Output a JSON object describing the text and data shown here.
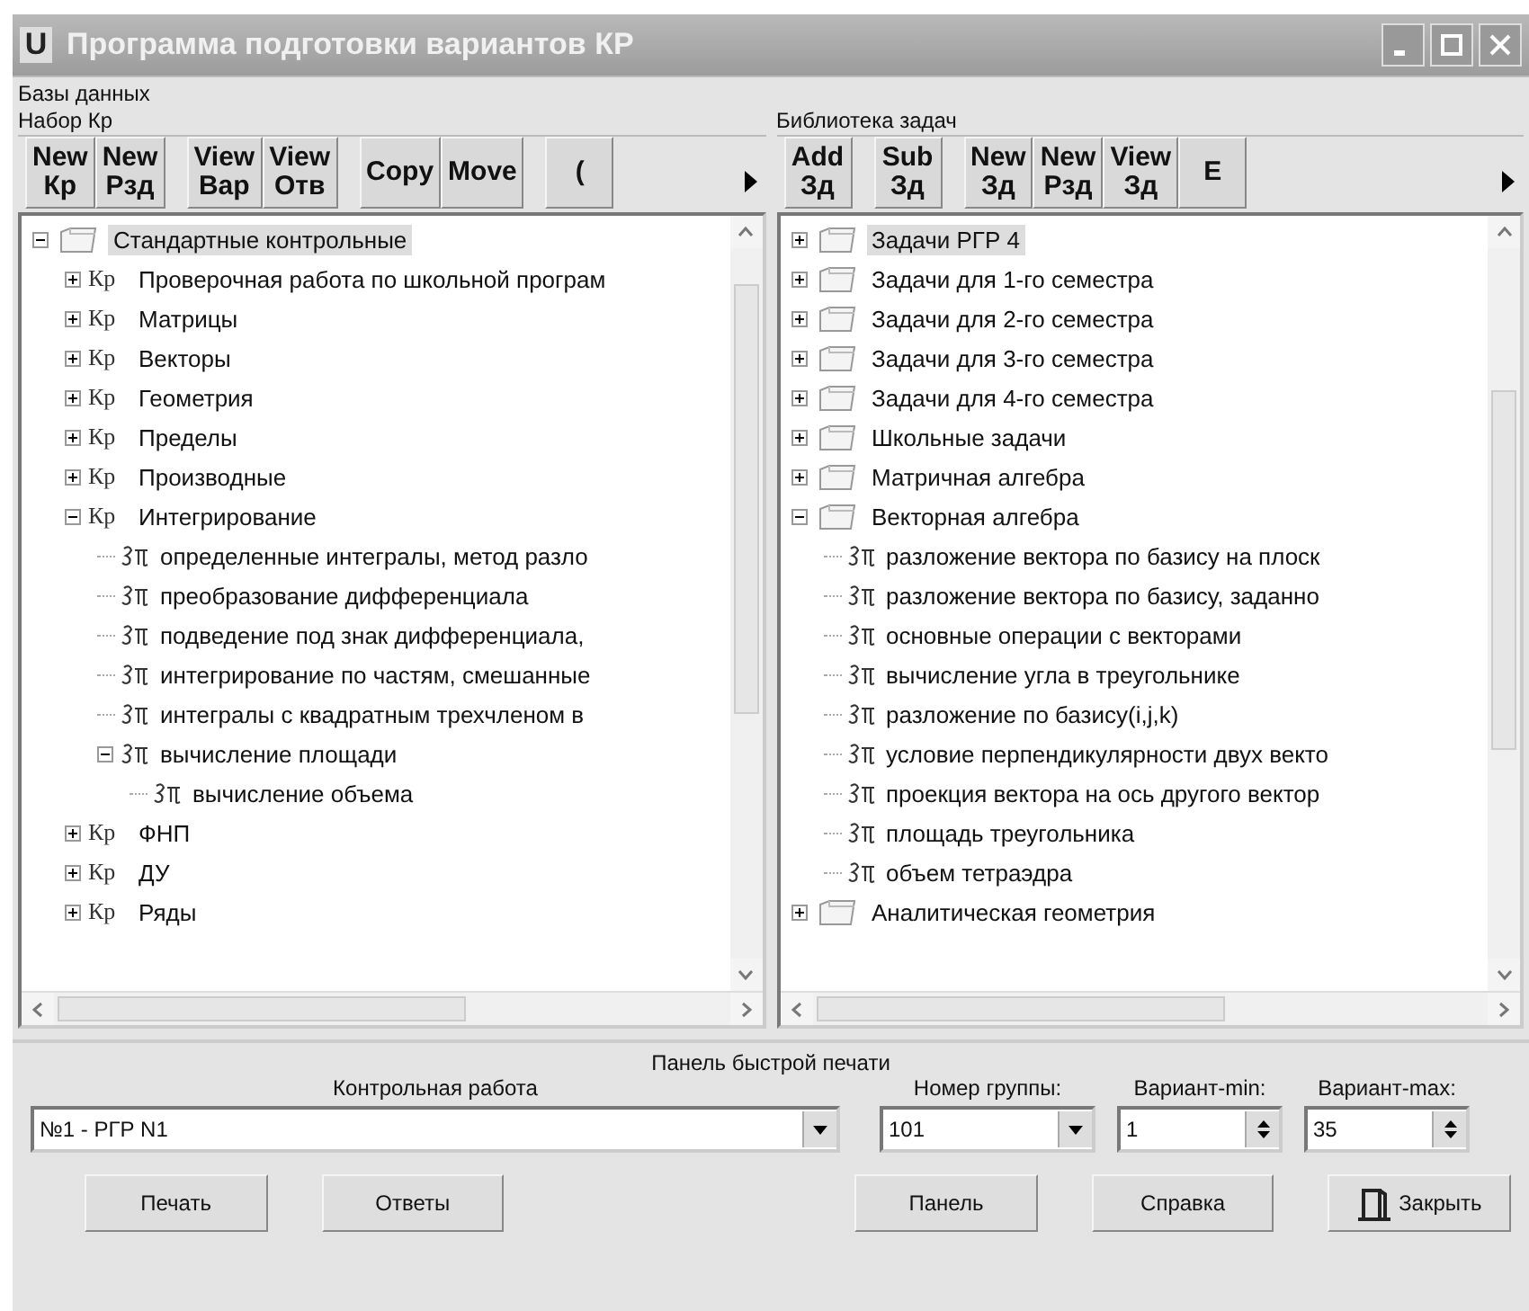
{
  "window": {
    "icon_letter": "U",
    "title": "Программа подготовки вариантов КР"
  },
  "databases_group": {
    "label": "Базы данных"
  },
  "left_panel": {
    "label": "Набор Кр",
    "toolbar": [
      [
        {
          "lines": [
            "New",
            "Кр"
          ]
        },
        {
          "lines": [
            "New",
            "Рзд"
          ]
        }
      ],
      [
        {
          "lines": [
            "View",
            "Вар"
          ]
        },
        {
          "lines": [
            "View",
            "Отв"
          ]
        }
      ],
      [
        {
          "lines": [
            "Copy"
          ]
        },
        {
          "lines": [
            "Move"
          ]
        }
      ],
      [
        {
          "lines": [
            "("
          ]
        }
      ]
    ],
    "tree": [
      {
        "kind": "folder",
        "label": "Стандартные контрольные",
        "expanded": true,
        "selected": true,
        "children": [
          {
            "kind": "kr",
            "badge": "Кр",
            "label": "Проверочная работа по школьной програм",
            "expanded": false,
            "selected": false
          },
          {
            "kind": "kr",
            "badge": "Кр",
            "label": "Матрицы",
            "expanded": false,
            "selected": false
          },
          {
            "kind": "kr",
            "badge": "Кр",
            "label": "Векторы",
            "expanded": false,
            "selected": false
          },
          {
            "kind": "kr",
            "badge": "Кр",
            "label": "Геометрия",
            "expanded": false,
            "selected": false
          },
          {
            "kind": "kr",
            "badge": "Кр",
            "label": "Пределы",
            "expanded": false,
            "selected": false
          },
          {
            "kind": "kr",
            "badge": "Кр",
            "label": "Производные",
            "expanded": false,
            "selected": false
          },
          {
            "kind": "kr",
            "badge": "Кр",
            "label": "Интегрирование",
            "expanded": true,
            "selected": false,
            "children": [
              {
                "kind": "task",
                "label": "определенные интегралы, метод разло",
                "selected": false
              },
              {
                "kind": "task",
                "label": "преобразование дифференциала",
                "selected": false
              },
              {
                "kind": "task",
                "label": "подведение под знак дифференциала,",
                "selected": false
              },
              {
                "kind": "task",
                "label": "интегрирование по частям, смешанные",
                "selected": false
              },
              {
                "kind": "task",
                "label": "интегралы с квадратным трехчленом в",
                "selected": false
              },
              {
                "kind": "task",
                "label": "вычисление площади",
                "expanded": true,
                "selected": false,
                "children": [
                  {
                    "kind": "task",
                    "label": "вычисление объема",
                    "selected": false
                  }
                ]
              }
            ]
          },
          {
            "kind": "kr",
            "badge": "Кр",
            "label": "ФНП",
            "expanded": false,
            "selected": false
          },
          {
            "kind": "kr",
            "badge": "Кр",
            "label": "ДУ",
            "expanded": false,
            "selected": false
          },
          {
            "kind": "kr",
            "badge": "Кр",
            "label": "Ряды",
            "expanded": false,
            "selected": false
          }
        ]
      }
    ]
  },
  "right_panel": {
    "label": "Библиотека задач",
    "toolbar": [
      [
        {
          "lines": [
            "Add",
            "Зд"
          ]
        }
      ],
      [
        {
          "lines": [
            "Sub",
            "Зд"
          ]
        }
      ],
      [
        {
          "lines": [
            "New",
            "Зд"
          ]
        },
        {
          "lines": [
            "New",
            "Рзд"
          ]
        },
        {
          "lines": [
            "View",
            "Зд"
          ]
        },
        {
          "lines": [
            "E"
          ]
        }
      ]
    ],
    "tree": [
      {
        "kind": "folder",
        "label": "Задачи РГР 4",
        "expanded": false,
        "selected": true
      },
      {
        "kind": "folder",
        "label": "Задачи для 1-го семестра",
        "expanded": false,
        "selected": false
      },
      {
        "kind": "folder",
        "label": "Задачи для 2-го семестра",
        "expanded": false,
        "selected": false
      },
      {
        "kind": "folder",
        "label": "Задачи для 3-го семестра",
        "expanded": false,
        "selected": false
      },
      {
        "kind": "folder",
        "label": "Задачи для 4-го семестра",
        "expanded": false,
        "selected": false
      },
      {
        "kind": "folder",
        "label": "Школьные задачи",
        "expanded": false,
        "selected": false
      },
      {
        "kind": "folder",
        "label": "Матричная алгебра",
        "expanded": false,
        "selected": false
      },
      {
        "kind": "folder",
        "label": "Векторная алгебра",
        "expanded": true,
        "selected": false,
        "children": [
          {
            "kind": "task",
            "label": "разложение вектора по базису на плоск",
            "selected": false
          },
          {
            "kind": "task",
            "label": "разложение вектора по базису, заданно",
            "selected": false
          },
          {
            "kind": "task",
            "label": "основные операции с векторами",
            "selected": false
          },
          {
            "kind": "task",
            "label": "вычисление угла в треугольнике",
            "selected": false
          },
          {
            "kind": "task",
            "label": "разложение по базису(i,j,k)",
            "selected": false
          },
          {
            "kind": "task",
            "label": "условие перпендикулярности двух векто",
            "selected": false
          },
          {
            "kind": "task",
            "label": "проекция вектора на ось другого вектор",
            "selected": false
          },
          {
            "kind": "task",
            "label": "площадь треугольника",
            "selected": false
          },
          {
            "kind": "task",
            "label": "объем тетраэдра",
            "selected": false
          }
        ]
      },
      {
        "kind": "folder",
        "label": "Аналитическая геометрия",
        "expanded": false,
        "selected": false
      }
    ]
  },
  "print_panel": {
    "title": "Панель быстрой печати",
    "fields": [
      {
        "kind": "combo",
        "label": "Контрольная работа",
        "value": "№1 - РГР N1"
      },
      {
        "kind": "combo",
        "label": "Номер группы:",
        "value": "101"
      },
      {
        "kind": "spin",
        "label": "Вариант-min:",
        "value": "1"
      },
      {
        "kind": "spin",
        "label": "Вариант-max:",
        "value": "35"
      }
    ],
    "buttons": [
      {
        "kind": "plain",
        "label": "Печать"
      },
      {
        "kind": "plain",
        "label": "Ответы"
      },
      {
        "kind": "plain",
        "label": "Панель"
      },
      {
        "kind": "plain",
        "label": "Справка"
      },
      {
        "kind": "door",
        "label": "Закрыть"
      }
    ]
  }
}
